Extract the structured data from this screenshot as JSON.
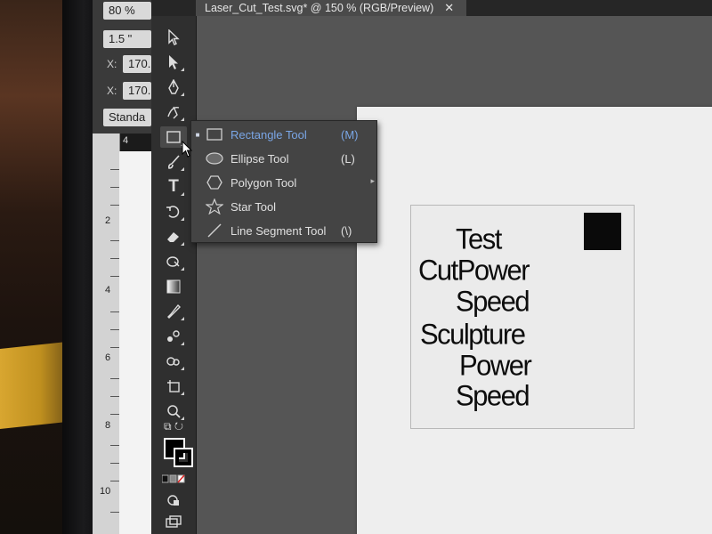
{
  "window": {
    "tab_title": "Laser_Cut_Test.svg* @ 150 % (RGB/Preview)",
    "close_glyph": "✕"
  },
  "control_bar": {
    "zoom": "80 %",
    "stroke_weight": "1.5 \"",
    "x_label": "X:",
    "x_value": "170.",
    "y_label": "X:",
    "y_value": "170.",
    "style": "Standa"
  },
  "ruler": {
    "ticks": [
      "4",
      "2",
      "4",
      "6",
      "8",
      "10"
    ]
  },
  "flyout_menu": {
    "items": [
      {
        "label": "Rectangle Tool",
        "shortcut": "(M)",
        "icon": "rectangle-icon",
        "active": true
      },
      {
        "label": "Ellipse Tool",
        "shortcut": "(L)",
        "icon": "ellipse-icon",
        "active": false
      },
      {
        "label": "Polygon Tool",
        "shortcut": "",
        "icon": "polygon-icon",
        "active": false
      },
      {
        "label": "Star Tool",
        "shortcut": "",
        "icon": "star-icon",
        "active": false
      },
      {
        "label": "Line Segment Tool",
        "shortcut": "(\\)",
        "icon": "line-segment-icon",
        "active": false
      }
    ],
    "active_color": "#7aa6e6"
  },
  "design_text": {
    "line1": "Test",
    "line2": "CutPower",
    "line3": "Speed",
    "line4": "Sculpture",
    "line5": "Power",
    "line6": "Speed"
  },
  "tools": [
    "selection-icon",
    "direct-selection-icon",
    "pen-icon",
    "curvature-icon",
    "rectangle-icon",
    "paintbrush-icon",
    "type-icon",
    "rotate-icon",
    "eraser-icon",
    "shape-builder-icon",
    "gradient-icon",
    "eyedropper-icon",
    "blend-icon",
    "symbol-sprayer-icon",
    "artboard-icon",
    "zoom-icon",
    "swap-icon",
    "fill-stroke-icon",
    "color-mode-icon",
    "draw-mode-icon",
    "screen-mode-icon"
  ]
}
